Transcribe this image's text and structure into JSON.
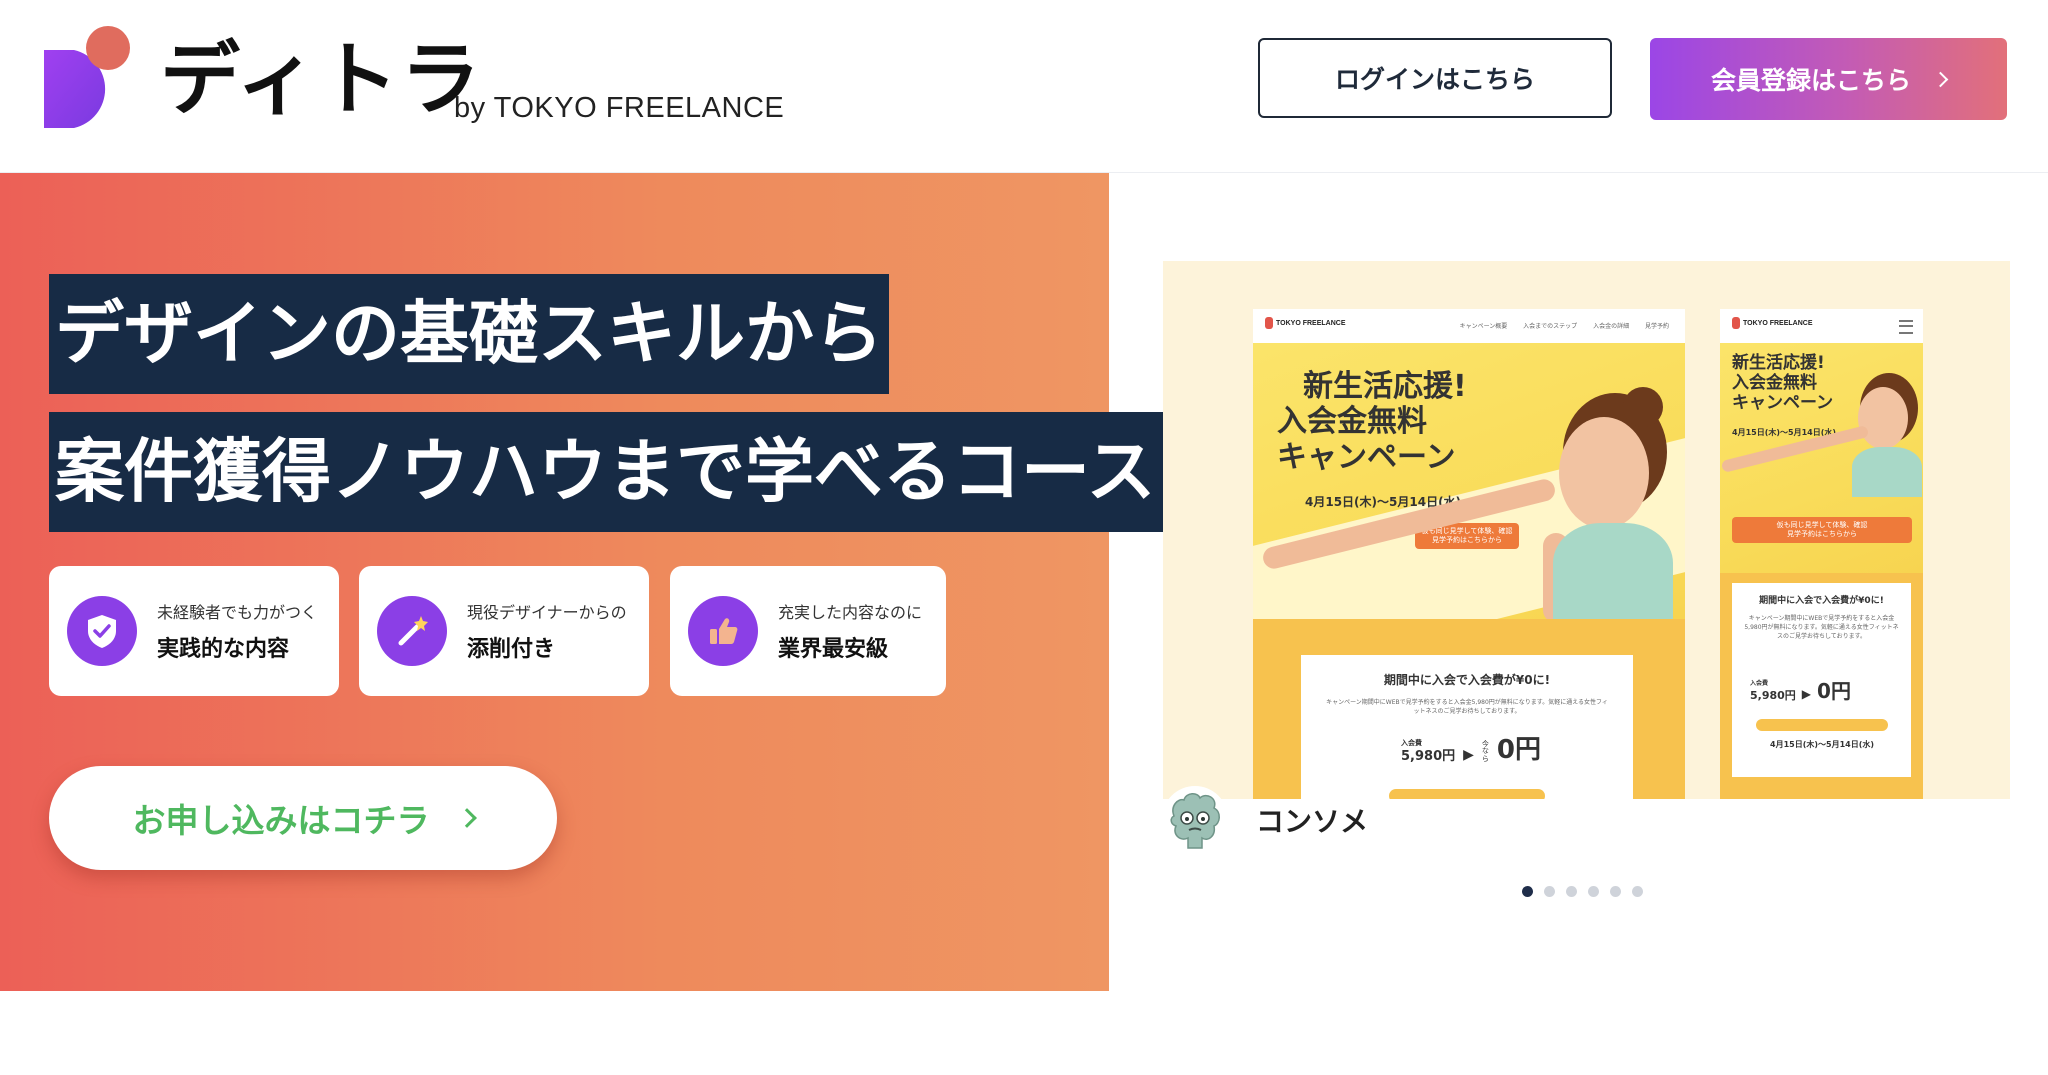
{
  "header": {
    "brand_name": "ディトラ",
    "brand_sub": "by TOKYO FREELANCE",
    "login_label": "ログインはこちら",
    "register_label": "会員登録はこちら"
  },
  "hero": {
    "headline_line1": "デザインの基礎スキルから",
    "headline_line2": "案件獲得ノウハウまで学べるコース!",
    "features": [
      {
        "icon": "shield-check-icon",
        "small": "未経験者でも力がつく",
        "big": "実践的な内容"
      },
      {
        "icon": "magic-wand-icon",
        "small": "現役デザイナーからの",
        "big": "添削付き"
      },
      {
        "icon": "thumbs-up-icon",
        "small": "充実した内容なのに",
        "big": "業界最安級"
      }
    ],
    "cta_label": "お申し込みはコチラ"
  },
  "carousel": {
    "author_name": "コンソメ",
    "slide_count": 6,
    "active_index": 0,
    "desktop_mock": {
      "logo": "TOKYO FREELANCE",
      "nav": "キャンペーン概要 入会までのステップ 入会金の詳細 見学予約",
      "title_line1": "新生活応援!",
      "title_line2": "入会金無料",
      "title_line3": "キャンペーン",
      "dates": "4月15日(木)〜5月14日(水)",
      "pill_line1": "仮も同じ見学して体験、確認",
      "pill_line2": "見学予約はこちらから",
      "card_title": "期間中に入会で入会費が¥0に!",
      "card_text": "キャンペーン期間中にWEBで見学予約をすると入会金5,980円が無料になります。気軽に通える女性フィットネスのご見学お待ちしております。",
      "price_label": "入会費",
      "price_before": "5,980円",
      "price_now_label": "今なら",
      "price_after": "0円"
    },
    "mobile_mock": {
      "logo": "TOKYO FREELANCE",
      "title_line1": "新生活応援!",
      "title_line2": "入会金無料",
      "title_line3": "キャンペーン",
      "dates": "4月15日(木)〜5月14日(水)",
      "pill_line1": "仮も同じ見学して体験、確認",
      "pill_line2": "見学予約はこちらから",
      "card_title": "期間中に入会で入会費が¥0に!",
      "card_text": "キャンペーン期間中にWEBで見学予約をすると入会金5,980円が無料になります。気軽に通える女性フィットネスのご見学お待ちしております。",
      "price_label": "入会費",
      "price_before": "5,980円",
      "price_after": "0円",
      "dates_bottom": "4月15日(木)〜5月14日(水)"
    }
  },
  "colors": {
    "brand_purple": "#8b3fe6",
    "hero_gradient_start": "#ec6057",
    "hero_gradient_end": "#ef9663",
    "headline_bg": "#172b45",
    "cta_green": "#4fb85f"
  }
}
